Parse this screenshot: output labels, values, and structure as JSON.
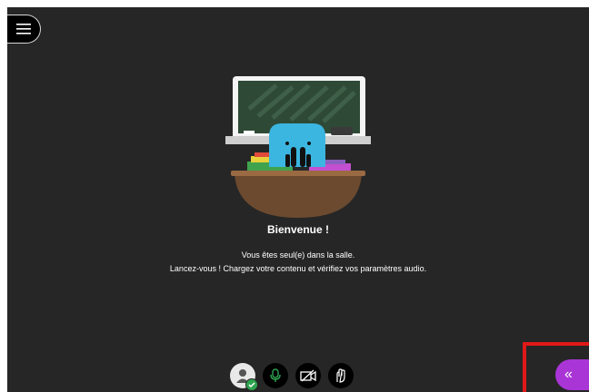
{
  "welcome": {
    "title": "Bienvenue !",
    "line1": "Vous êtes seul(e) dans la salle.",
    "line2": "Lancez-vous ! Chargez votre contenu et vérifiez vos paramètres audio."
  },
  "controls": [
    {
      "icon": "avatar-icon",
      "status": "connected"
    },
    {
      "icon": "microphone-icon",
      "state": "on",
      "color": "#2ea44f"
    },
    {
      "icon": "camera-off-icon",
      "state": "off"
    },
    {
      "icon": "raise-hand-icon"
    }
  ],
  "panel_toggle": {
    "icon": "chevron-double-left-icon",
    "glyph": "«",
    "color": "#a935d6"
  },
  "menu": {
    "icon": "hamburger-menu-icon"
  },
  "colors": {
    "background": "#262626",
    "accent": "#a935d6",
    "highlight": "#e01818"
  }
}
